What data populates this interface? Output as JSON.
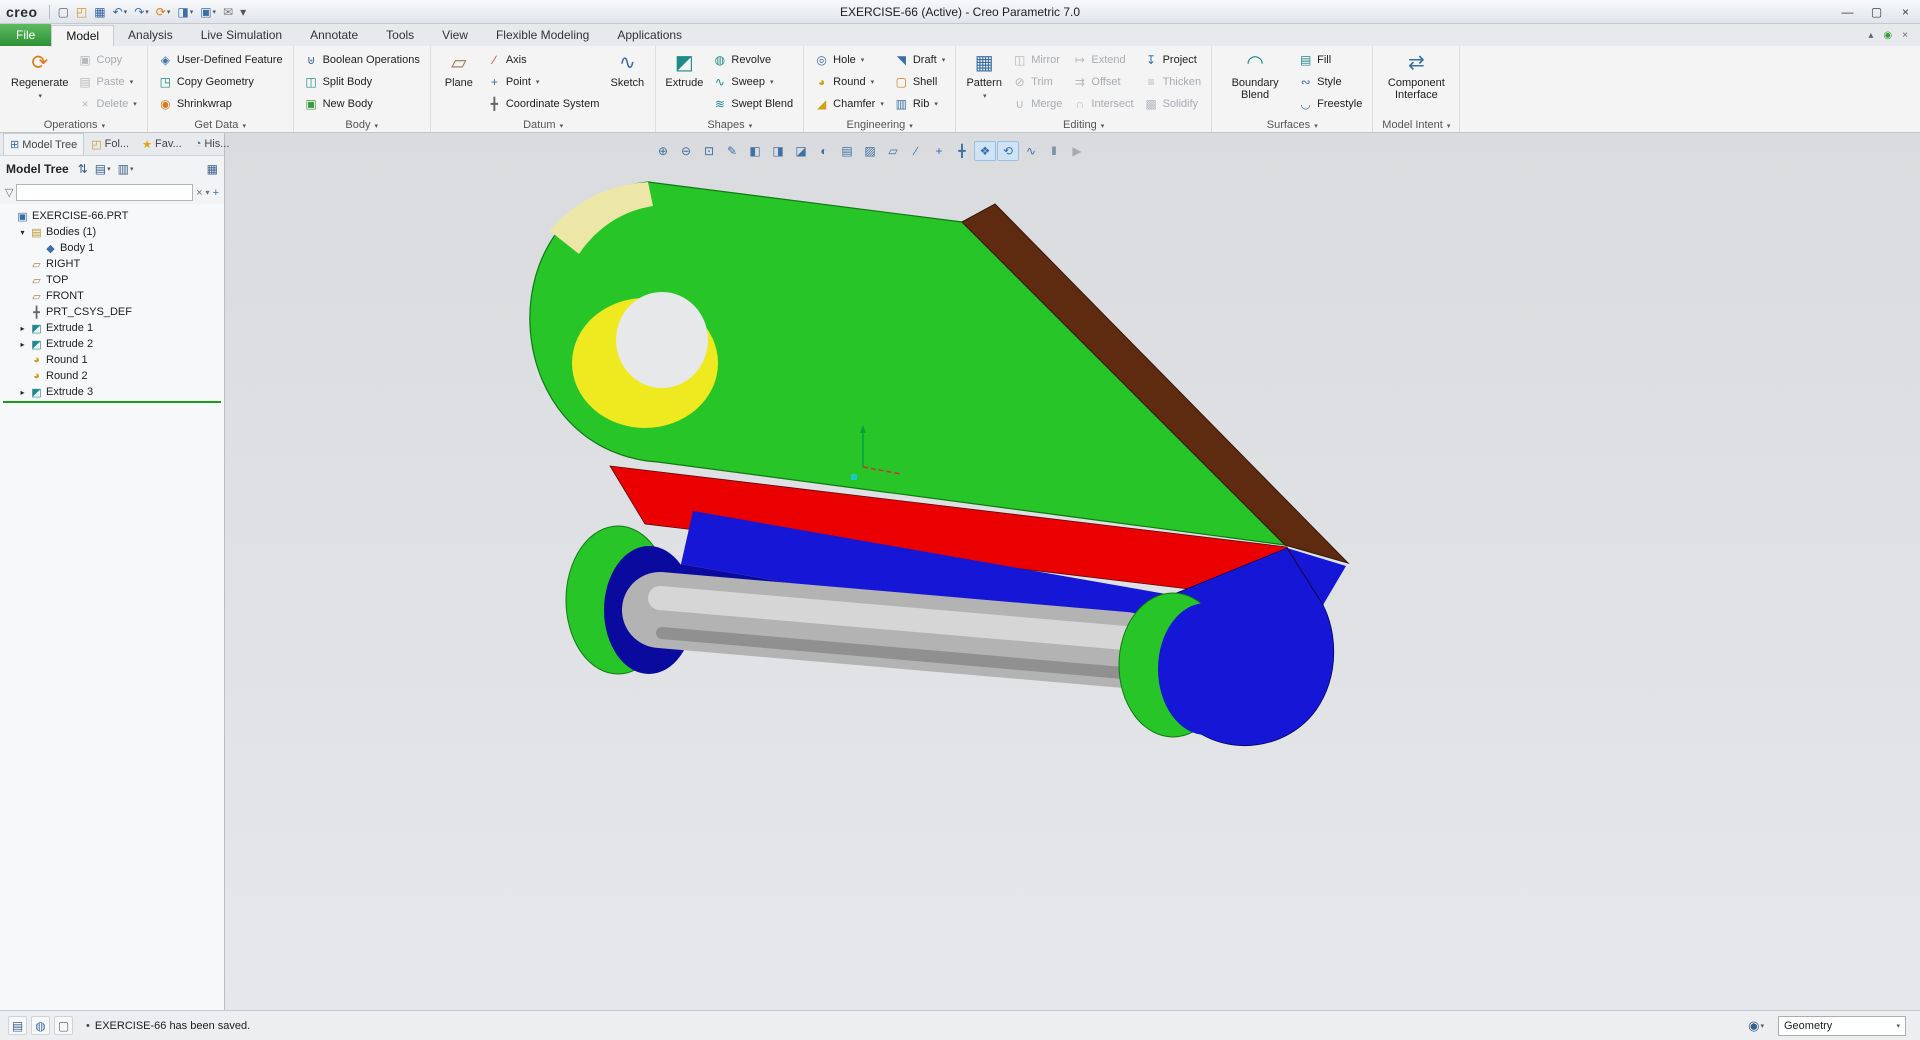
{
  "window": {
    "brand": "creo",
    "title": "EXERCISE-66 (Active) - Creo Parametric 7.0",
    "controls": [
      {
        "name": "minimize"
      },
      {
        "name": "maximize"
      },
      {
        "name": "close"
      }
    ]
  },
  "quick_access": [
    {
      "name": "new-file"
    },
    {
      "name": "open"
    },
    {
      "name": "save"
    },
    {
      "name": "undo",
      "dd": true
    },
    {
      "name": "redo",
      "dd": true
    },
    {
      "name": "regenerate",
      "dd": true
    },
    {
      "name": "display",
      "dd": true
    },
    {
      "name": "windows",
      "dd": true
    },
    {
      "name": "mail"
    },
    {
      "name": "customize"
    }
  ],
  "ribbon_tabs": [
    {
      "label": "File",
      "type": "file"
    },
    {
      "label": "Model",
      "active": true
    },
    {
      "label": "Analysis"
    },
    {
      "label": "Live Simulation"
    },
    {
      "label": "Annotate"
    },
    {
      "label": "Tools"
    },
    {
      "label": "View"
    },
    {
      "label": "Flexible Modeling"
    },
    {
      "label": "Applications"
    }
  ],
  "ribbon_right": [
    {
      "name": "collapse"
    },
    {
      "name": "presence"
    },
    {
      "name": "closex"
    }
  ],
  "ribbon_groups": [
    {
      "label": "Operations",
      "items": [
        {
          "type": "large",
          "label": "Regenerate",
          "icon": "regenerate",
          "dd": true
        },
        {
          "type": "col",
          "buttons": [
            {
              "label": "Copy",
              "icon": "copy",
              "disabled": true
            },
            {
              "label": "Paste",
              "icon": "paste",
              "disabled": true,
              "dd": true
            },
            {
              "label": "Delete",
              "icon": "delete",
              "disabled": true,
              "dd": true
            }
          ]
        }
      ]
    },
    {
      "label": "Get Data",
      "items": [
        {
          "type": "col",
          "buttons": [
            {
              "label": "User-Defined Feature",
              "icon": "udf"
            },
            {
              "label": "Copy Geometry",
              "icon": "copy-geometry"
            },
            {
              "label": "Shrinkwrap",
              "icon": "shrinkwrap"
            }
          ]
        }
      ]
    },
    {
      "label": "Body",
      "items": [
        {
          "type": "col",
          "buttons": [
            {
              "label": "Boolean Operations",
              "icon": "boolean"
            },
            {
              "label": "Split Body",
              "icon": "split-body"
            },
            {
              "label": "New Body",
              "icon": "new-body"
            }
          ]
        }
      ]
    },
    {
      "label": "Datum",
      "items": [
        {
          "type": "large",
          "label": "Plane",
          "icon": "plane"
        },
        {
          "type": "col",
          "buttons": [
            {
              "label": "Axis",
              "icon": "axis"
            },
            {
              "label": "Point",
              "icon": "point",
              "dd": true
            },
            {
              "label": "Coordinate System",
              "icon": "csys"
            }
          ]
        },
        {
          "type": "large",
          "label": "Sketch",
          "icon": "sketch"
        }
      ]
    },
    {
      "label": "Shapes",
      "items": [
        {
          "type": "large",
          "label": "Extrude",
          "icon": "extrude"
        },
        {
          "type": "col",
          "buttons": [
            {
              "label": "Revolve",
              "icon": "revolve"
            },
            {
              "label": "Sweep",
              "icon": "sweep",
              "dd": true
            },
            {
              "label": "Swept Blend",
              "icon": "swept-blend"
            }
          ]
        }
      ]
    },
    {
      "label": "Engineering",
      "items": [
        {
          "type": "col",
          "buttons": [
            {
              "label": "Hole",
              "icon": "hole",
              "dd": true
            },
            {
              "label": "Round",
              "icon": "round",
              "dd": true
            },
            {
              "label": "Chamfer",
              "icon": "chamfer",
              "dd": true
            }
          ]
        },
        {
          "type": "col",
          "buttons": [
            {
              "label": "Draft",
              "icon": "draft",
              "dd": true
            },
            {
              "label": "Shell",
              "icon": "shell"
            },
            {
              "label": "Rib",
              "icon": "rib",
              "dd": true
            }
          ]
        }
      ]
    },
    {
      "label": "Editing",
      "items": [
        {
          "type": "large",
          "label": "Pattern",
          "icon": "pattern",
          "dd": true
        },
        {
          "type": "col",
          "buttons": [
            {
              "label": "Mirror",
              "icon": "mirror",
              "disabled": true
            },
            {
              "label": "Trim",
              "icon": "trim",
              "disabled": true
            },
            {
              "label": "Merge",
              "icon": "merge",
              "disabled": true
            }
          ]
        },
        {
          "type": "col",
          "buttons": [
            {
              "label": "Extend",
              "icon": "extend",
              "disabled": true
            },
            {
              "label": "Offset",
              "icon": "offset",
              "disabled": true
            },
            {
              "label": "Intersect",
              "icon": "intersect",
              "disabled": true
            }
          ]
        },
        {
          "type": "col",
          "buttons": [
            {
              "label": "Project",
              "icon": "project"
            },
            {
              "label": "Thicken",
              "icon": "thicken",
              "disabled": true
            },
            {
              "label": "Solidify",
              "icon": "solidify",
              "disabled": true
            }
          ]
        }
      ]
    },
    {
      "label": "Surfaces",
      "items": [
        {
          "type": "large",
          "label": "Boundary Blend",
          "icon": "boundary-blend"
        },
        {
          "type": "col",
          "buttons": [
            {
              "label": "Fill",
              "icon": "fill"
            },
            {
              "label": "Style",
              "icon": "style"
            },
            {
              "label": "Freestyle",
              "icon": "freestyle"
            }
          ]
        }
      ]
    },
    {
      "label": "Model Intent",
      "items": [
        {
          "type": "large",
          "label": "Component Interface",
          "icon": "component-interface"
        }
      ]
    }
  ],
  "tree_panel": {
    "tabs": [
      {
        "label": "Model Tree",
        "icon": "model-tree",
        "active": true
      },
      {
        "label": "Fol...",
        "icon": "folder"
      },
      {
        "label": "Fav...",
        "icon": "favorites"
      },
      {
        "label": "His...",
        "icon": "history"
      }
    ],
    "header": {
      "title": "Model Tree",
      "icons": [
        {
          "name": "tree-settings"
        },
        {
          "name": "tree-view",
          "dd": true
        },
        {
          "name": "tree-options",
          "dd": true
        },
        {
          "name": "tree-columns",
          "last": true
        }
      ]
    },
    "filter": {
      "value": "",
      "placeholder": ""
    },
    "nodes": [
      {
        "label": "EXERCISE-66.PRT",
        "icon": "part",
        "indent": 0
      },
      {
        "label": "Bodies (1)",
        "icon": "bodies-folder",
        "indent": 1,
        "expander": "open"
      },
      {
        "label": "Body 1",
        "icon": "body",
        "indent": 2
      },
      {
        "label": "RIGHT",
        "icon": "datum-plane",
        "indent": 1
      },
      {
        "label": "TOP",
        "icon": "datum-plane",
        "indent": 1
      },
      {
        "label": "FRONT",
        "icon": "datum-plane",
        "indent": 1
      },
      {
        "label": "PRT_CSYS_DEF",
        "icon": "csys",
        "indent": 1
      },
      {
        "label": "Extrude 1",
        "icon": "extrude",
        "indent": 1,
        "expander": "closed"
      },
      {
        "label": "Extrude 2",
        "icon": "extrude",
        "indent": 1,
        "expander": "closed"
      },
      {
        "label": "Round 1",
        "icon": "round",
        "indent": 1
      },
      {
        "label": "Round 2",
        "icon": "round",
        "indent": 1
      },
      {
        "label": "Extrude 3",
        "icon": "extrude",
        "indent": 1,
        "expander": "closed",
        "insert_marker": true
      }
    ]
  },
  "graphics_toolbar": [
    {
      "name": "zoom-in"
    },
    {
      "name": "zoom-out"
    },
    {
      "name": "refit"
    },
    {
      "name": "repaint"
    },
    {
      "name": "display-style"
    },
    {
      "name": "shading"
    },
    {
      "name": "section"
    },
    {
      "name": "appearance"
    },
    {
      "name": "annotations"
    },
    {
      "name": "scene"
    },
    {
      "name": "datum-plane-display"
    },
    {
      "name": "datum-axis-display"
    },
    {
      "name": "datum-point-display"
    },
    {
      "name": "datum-csys-display"
    },
    {
      "name": "spin-center",
      "pressed": true
    },
    {
      "name": "dragger",
      "pressed": true
    },
    {
      "name": "sketcher-display"
    },
    {
      "name": "pause"
    },
    {
      "name": "flip-regen",
      "disabled": true
    }
  ],
  "viewport": {
    "model_colors": {
      "green": "#28c528",
      "cream": "#ece7a6",
      "yellow": "#efe920",
      "brown": "#5e2a10",
      "red": "#ea0000",
      "blue": "#1616d6",
      "dark_blue": "#0a0a9e",
      "gray": "#b3b3b3",
      "gray_light": "#d6d6d6",
      "gray_dark": "#909090"
    }
  },
  "status_bar": {
    "bullet": "•",
    "message": "EXERCISE-66 has been saved.",
    "left_icons": [
      {
        "name": "tree-toggle"
      },
      {
        "name": "web"
      },
      {
        "name": "page"
      }
    ],
    "selection_filter": "Geometry"
  }
}
